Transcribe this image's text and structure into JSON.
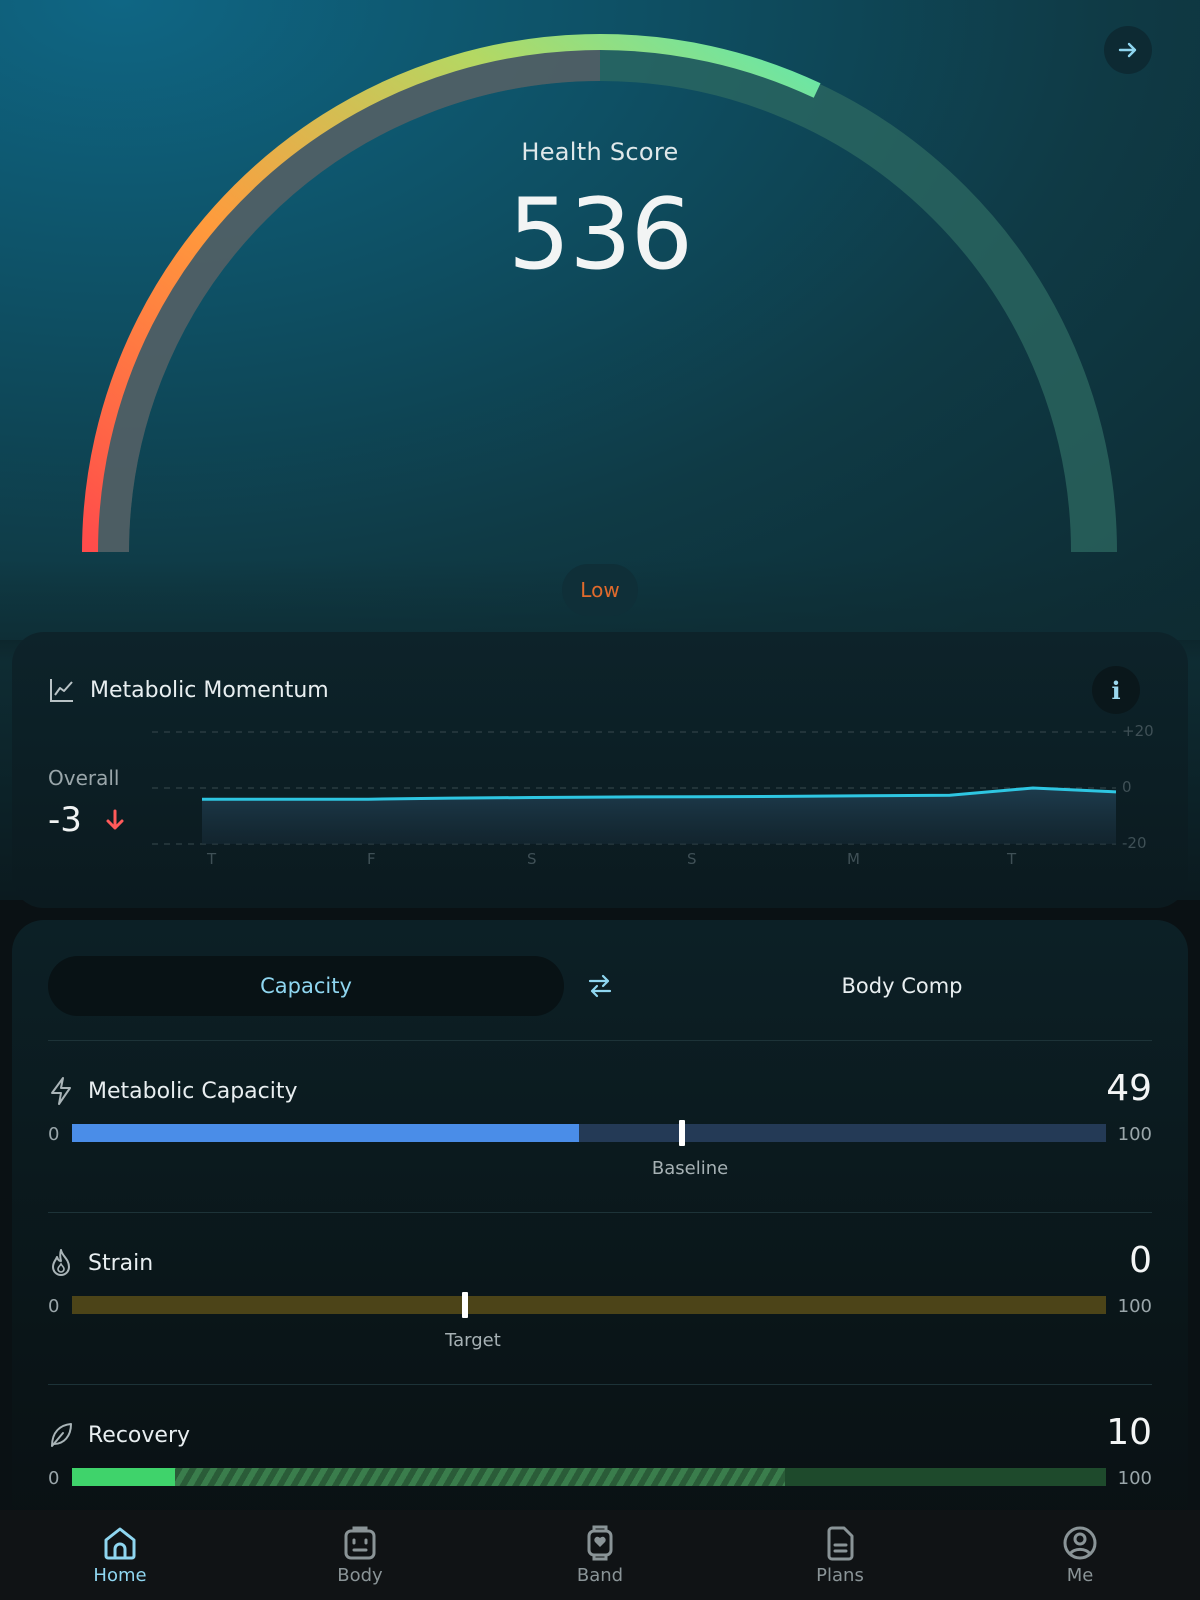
{
  "header": {
    "score_label": "Health Score",
    "score_value": "536",
    "status": "Low",
    "score_fraction": 0.64,
    "colors": {
      "arc_low": "#ff4b4b",
      "arc_mid": "#ff9a3c",
      "arc_high": "#5fe8b0",
      "status": "#e06a2c"
    }
  },
  "momentum": {
    "title": "Metabolic Momentum",
    "info": "i",
    "overall_label": "Overall",
    "overall_value": "-3",
    "chart_data": {
      "type": "area",
      "categories": [
        "T",
        "F",
        "S",
        "S",
        "M",
        "T"
      ],
      "y_ticks": [
        "+20",
        "0",
        "-20"
      ],
      "ylim": [
        -20,
        20
      ],
      "values": [
        -4,
        -4,
        -4,
        -3.6,
        -3.4,
        -3.2,
        -3.1,
        -3,
        -2.8,
        -2.6,
        0,
        -1.4
      ],
      "color": "#2ec6e2"
    }
  },
  "toggle": {
    "active": "Capacity",
    "inactive": "Body Comp"
  },
  "metrics": [
    {
      "name": "Metabolic Capacity",
      "value": "49",
      "min": "0",
      "max": "100",
      "fill": 49,
      "marker": 59,
      "marker_label": "Baseline",
      "fill_color": "#4a8de8",
      "track_color": "#243a56"
    },
    {
      "name": "Strain",
      "value": "0",
      "min": "0",
      "max": "100",
      "fill": 0,
      "marker": 38,
      "marker_label": "Target",
      "fill_color": "#5a4e1c",
      "track_color": "#4c4418"
    },
    {
      "name": "Recovery",
      "value": "10",
      "min": "0",
      "max": "100",
      "fill": 10,
      "projected": 69,
      "fill_color": "#3fd36b",
      "track_color": "#1e4a2c"
    }
  ],
  "nav": [
    {
      "label": "Home",
      "icon": "home-icon",
      "active": true
    },
    {
      "label": "Body",
      "icon": "body-icon",
      "active": false
    },
    {
      "label": "Band",
      "icon": "band-icon",
      "active": false
    },
    {
      "label": "Plans",
      "icon": "plans-icon",
      "active": false
    },
    {
      "label": "Me",
      "icon": "profile-icon",
      "active": false
    }
  ]
}
